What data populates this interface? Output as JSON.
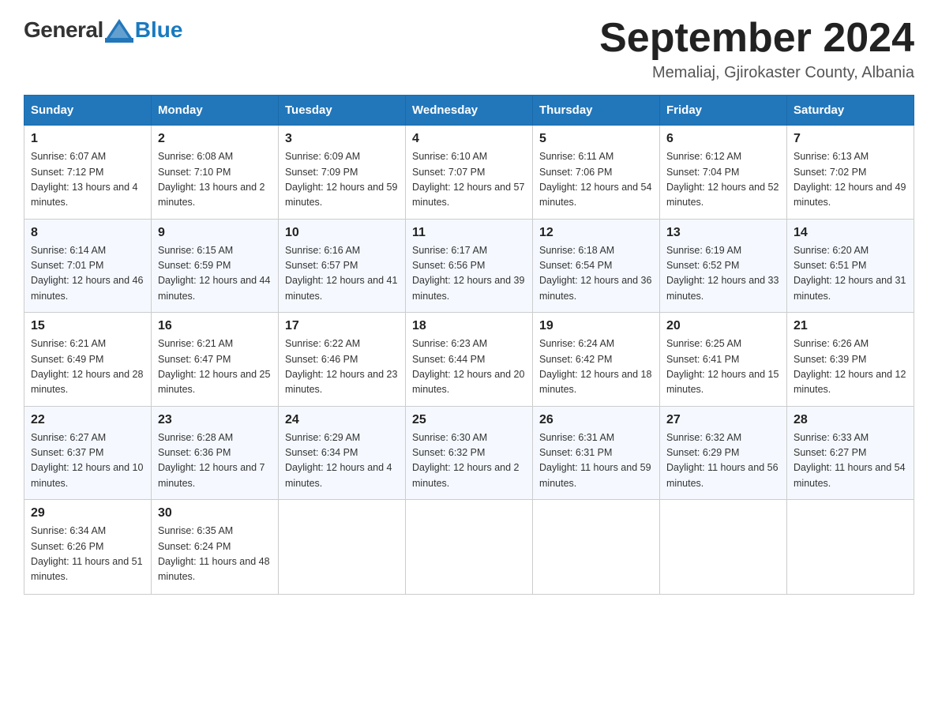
{
  "header": {
    "logo_general": "General",
    "logo_blue": "Blue",
    "title": "September 2024",
    "location": "Memaliaj, Gjirokaster County, Albania"
  },
  "days_of_week": [
    "Sunday",
    "Monday",
    "Tuesday",
    "Wednesday",
    "Thursday",
    "Friday",
    "Saturday"
  ],
  "weeks": [
    [
      {
        "num": "1",
        "sunrise": "6:07 AM",
        "sunset": "7:12 PM",
        "daylight": "13 hours and 4 minutes."
      },
      {
        "num": "2",
        "sunrise": "6:08 AM",
        "sunset": "7:10 PM",
        "daylight": "13 hours and 2 minutes."
      },
      {
        "num": "3",
        "sunrise": "6:09 AM",
        "sunset": "7:09 PM",
        "daylight": "12 hours and 59 minutes."
      },
      {
        "num": "4",
        "sunrise": "6:10 AM",
        "sunset": "7:07 PM",
        "daylight": "12 hours and 57 minutes."
      },
      {
        "num": "5",
        "sunrise": "6:11 AM",
        "sunset": "7:06 PM",
        "daylight": "12 hours and 54 minutes."
      },
      {
        "num": "6",
        "sunrise": "6:12 AM",
        "sunset": "7:04 PM",
        "daylight": "12 hours and 52 minutes."
      },
      {
        "num": "7",
        "sunrise": "6:13 AM",
        "sunset": "7:02 PM",
        "daylight": "12 hours and 49 minutes."
      }
    ],
    [
      {
        "num": "8",
        "sunrise": "6:14 AM",
        "sunset": "7:01 PM",
        "daylight": "12 hours and 46 minutes."
      },
      {
        "num": "9",
        "sunrise": "6:15 AM",
        "sunset": "6:59 PM",
        "daylight": "12 hours and 44 minutes."
      },
      {
        "num": "10",
        "sunrise": "6:16 AM",
        "sunset": "6:57 PM",
        "daylight": "12 hours and 41 minutes."
      },
      {
        "num": "11",
        "sunrise": "6:17 AM",
        "sunset": "6:56 PM",
        "daylight": "12 hours and 39 minutes."
      },
      {
        "num": "12",
        "sunrise": "6:18 AM",
        "sunset": "6:54 PM",
        "daylight": "12 hours and 36 minutes."
      },
      {
        "num": "13",
        "sunrise": "6:19 AM",
        "sunset": "6:52 PM",
        "daylight": "12 hours and 33 minutes."
      },
      {
        "num": "14",
        "sunrise": "6:20 AM",
        "sunset": "6:51 PM",
        "daylight": "12 hours and 31 minutes."
      }
    ],
    [
      {
        "num": "15",
        "sunrise": "6:21 AM",
        "sunset": "6:49 PM",
        "daylight": "12 hours and 28 minutes."
      },
      {
        "num": "16",
        "sunrise": "6:21 AM",
        "sunset": "6:47 PM",
        "daylight": "12 hours and 25 minutes."
      },
      {
        "num": "17",
        "sunrise": "6:22 AM",
        "sunset": "6:46 PM",
        "daylight": "12 hours and 23 minutes."
      },
      {
        "num": "18",
        "sunrise": "6:23 AM",
        "sunset": "6:44 PM",
        "daylight": "12 hours and 20 minutes."
      },
      {
        "num": "19",
        "sunrise": "6:24 AM",
        "sunset": "6:42 PM",
        "daylight": "12 hours and 18 minutes."
      },
      {
        "num": "20",
        "sunrise": "6:25 AM",
        "sunset": "6:41 PM",
        "daylight": "12 hours and 15 minutes."
      },
      {
        "num": "21",
        "sunrise": "6:26 AM",
        "sunset": "6:39 PM",
        "daylight": "12 hours and 12 minutes."
      }
    ],
    [
      {
        "num": "22",
        "sunrise": "6:27 AM",
        "sunset": "6:37 PM",
        "daylight": "12 hours and 10 minutes."
      },
      {
        "num": "23",
        "sunrise": "6:28 AM",
        "sunset": "6:36 PM",
        "daylight": "12 hours and 7 minutes."
      },
      {
        "num": "24",
        "sunrise": "6:29 AM",
        "sunset": "6:34 PM",
        "daylight": "12 hours and 4 minutes."
      },
      {
        "num": "25",
        "sunrise": "6:30 AM",
        "sunset": "6:32 PM",
        "daylight": "12 hours and 2 minutes."
      },
      {
        "num": "26",
        "sunrise": "6:31 AM",
        "sunset": "6:31 PM",
        "daylight": "11 hours and 59 minutes."
      },
      {
        "num": "27",
        "sunrise": "6:32 AM",
        "sunset": "6:29 PM",
        "daylight": "11 hours and 56 minutes."
      },
      {
        "num": "28",
        "sunrise": "6:33 AM",
        "sunset": "6:27 PM",
        "daylight": "11 hours and 54 minutes."
      }
    ],
    [
      {
        "num": "29",
        "sunrise": "6:34 AM",
        "sunset": "6:26 PM",
        "daylight": "11 hours and 51 minutes."
      },
      {
        "num": "30",
        "sunrise": "6:35 AM",
        "sunset": "6:24 PM",
        "daylight": "11 hours and 48 minutes."
      },
      null,
      null,
      null,
      null,
      null
    ]
  ]
}
